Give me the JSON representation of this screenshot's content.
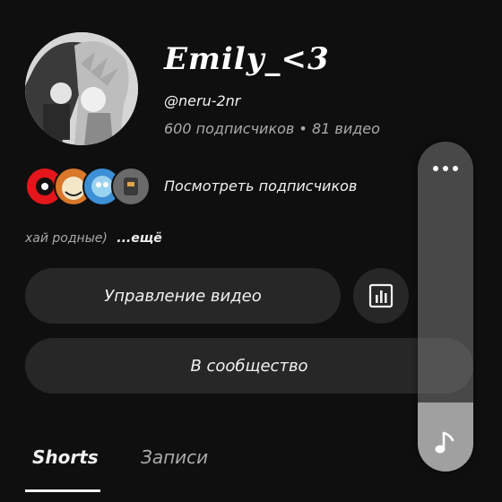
{
  "channel": {
    "name": "Emily_<3",
    "handle": "@neru-2nr",
    "stats": "600 подписчиков • 81 видео",
    "description": "хай родные)",
    "description_more": "...ещё"
  },
  "subscribers": {
    "link_label": "Посмотреть подписчиков",
    "avatar_colors": [
      "#e4161b",
      "#d9772a",
      "#3d8fd6",
      "#6a6a6a"
    ]
  },
  "actions": {
    "manage_videos_label": "Управление видео",
    "analytics_icon": "bar-chart-icon",
    "community_label": "В сообщество"
  },
  "tabs": [
    {
      "label": "Shorts",
      "active": true
    },
    {
      "label": "Записи",
      "active": false
    }
  ],
  "floating_panel": {
    "menu_icon": "more-horizontal-icon",
    "music_icon": "music-note-icon",
    "level": 0.21
  },
  "colors": {
    "background": "#0f0f0f",
    "button_bg": "#272727",
    "text_primary": "#f1f1f1",
    "text_secondary": "#aaaaaa"
  }
}
